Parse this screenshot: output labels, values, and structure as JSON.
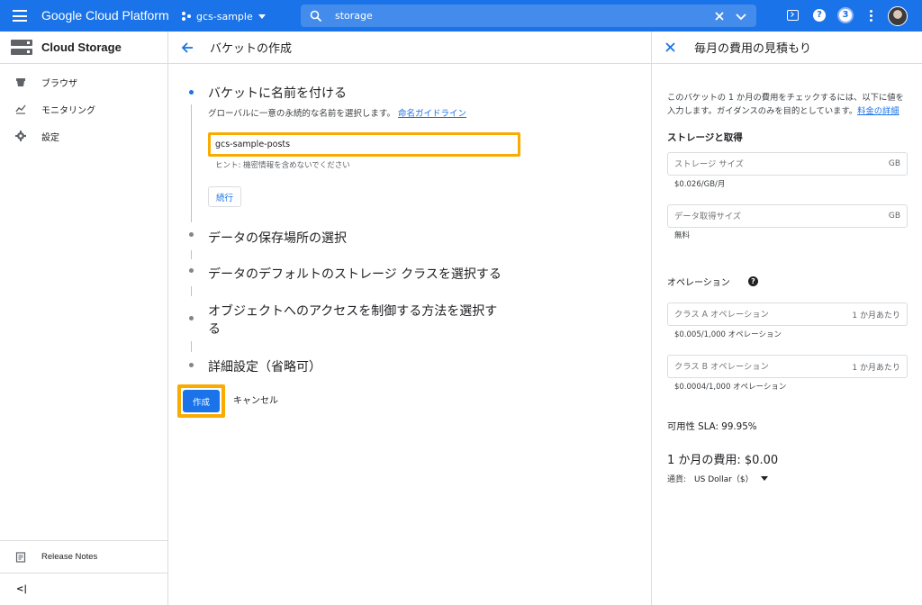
{
  "topbar": {
    "brand": "Google Cloud Platform",
    "project": "gcs-sample",
    "search_value": "storage",
    "notification_count": "3",
    "accent": "#1a73e8"
  },
  "leftnav": {
    "title": "Cloud Storage",
    "items": [
      {
        "label": "ブラウザ",
        "icon": "bucket-icon"
      },
      {
        "label": "モニタリング",
        "icon": "chart-icon"
      },
      {
        "label": "設定",
        "icon": "gear-icon"
      }
    ],
    "release_notes": "Release Notes",
    "collapse_label": "<|"
  },
  "main": {
    "title": "バケットの作成",
    "steps": [
      {
        "title": "バケットに名前を付ける"
      },
      {
        "title": "データの保存場所の選択"
      },
      {
        "title": "データのデフォルトのストレージ クラスを選択する"
      },
      {
        "title": "オブジェクトへのアクセスを制御する方法を選択す",
        "title_line2": "る"
      },
      {
        "title": "詳細設定（省略可）"
      }
    ],
    "name_step": {
      "description": "グローバルに一意の永続的な名前を選択します。",
      "guide_link": "命名ガイドライン",
      "input_value": "gcs-sample-posts",
      "hint": "ヒント: 機密情報を含めないでください",
      "continue_label": "続行"
    },
    "create_label": "作成",
    "cancel_label": "キャンセル",
    "highlight_color": "#f9ab00"
  },
  "estimate": {
    "title": "毎月の費用の見積もり",
    "intro": "このバケットの 1 か月の費用をチェックするには、以下に値を入力します。ガイダンスのみを目的としています。",
    "pricing_link": "料金の詳細",
    "storage_section": "ストレージと取得",
    "storage_size_placeholder": "ストレージ サイズ",
    "storage_size_unit": "GB",
    "storage_price": "$0.026/GB/月",
    "retrieval_placeholder": "データ取得サイズ",
    "retrieval_unit": "GB",
    "retrieval_price": "無料",
    "operations_section": "オペレーション",
    "class_a_placeholder": "クラス A オペレーション",
    "class_a_unit": "1 か月あたり",
    "class_a_price": "$0.005/1,000 オペレーション",
    "class_b_placeholder": "クラス B オペレーション",
    "class_b_unit": "1 か月あたり",
    "class_b_price": "$0.0004/1,000 オペレーション",
    "sla": "可用性 SLA: 99.95%",
    "monthly_cost": "1 か月の費用: $0.00",
    "currency_label": "通貨:",
    "currency_value": "US Dollar（$）"
  }
}
